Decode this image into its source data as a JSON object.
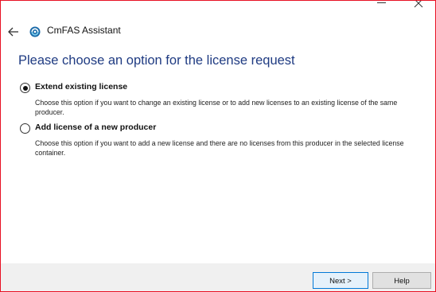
{
  "window": {
    "title": "CmFAS Assistant",
    "minimize_icon": "minimize-icon",
    "close_icon": "close-icon"
  },
  "header": {
    "back_icon": "arrow-left-icon",
    "logo_icon": "codemeter-logo-icon",
    "app_title": "CmFAS Assistant"
  },
  "page": {
    "title": "Please choose an option for the license request"
  },
  "options": [
    {
      "label": "Extend existing license",
      "description": "Choose this option if you want to change an existing license or to add new licenses to an existing license of the same producer.",
      "selected": true
    },
    {
      "label": "Add license of a new producer",
      "description": "Choose this option if you want to add a new license and there are no licenses from this producer in the selected license container.",
      "selected": false
    }
  ],
  "footer": {
    "next_label": "Next >",
    "help_label": "Help"
  },
  "colors": {
    "title_blue": "#1f3b82",
    "window_border": "#e81123",
    "footer_bg": "#f0f0f0",
    "default_button_border": "#0078d7"
  }
}
